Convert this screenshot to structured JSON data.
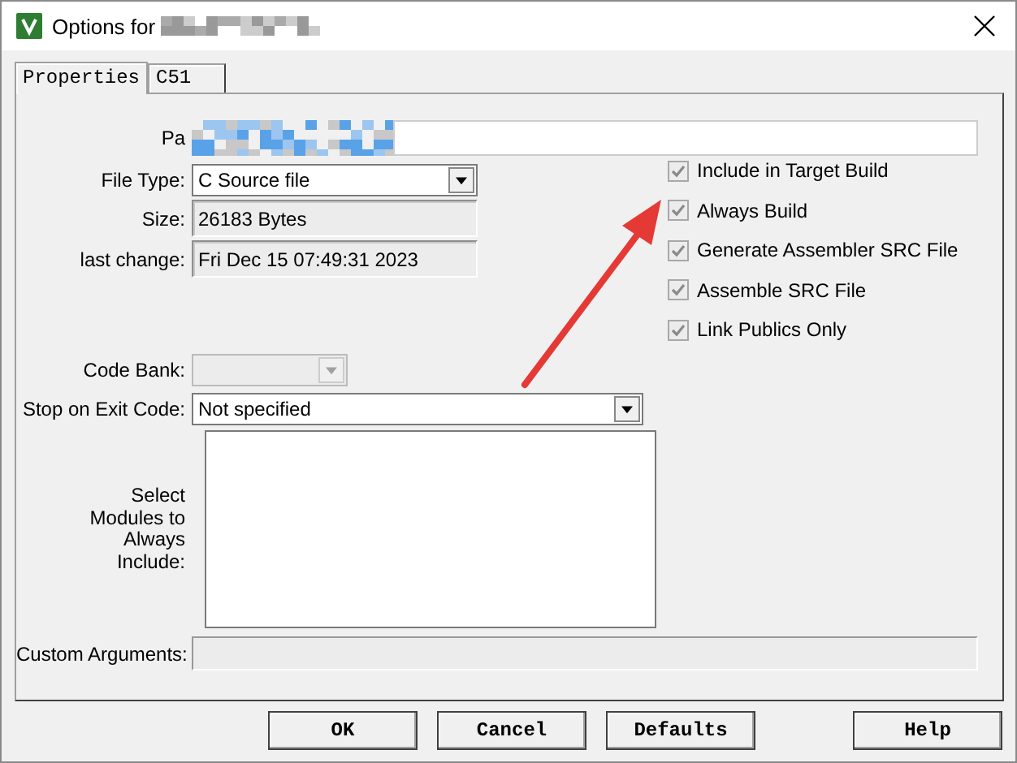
{
  "window": {
    "title": "Options for"
  },
  "tabs": [
    {
      "label": "Properties",
      "selected": true
    },
    {
      "label": "C51",
      "selected": false
    }
  ],
  "path": {
    "label": "Pa"
  },
  "file_type": {
    "label": "File Type:",
    "value": "C Source file"
  },
  "size": {
    "label": "Size:",
    "value": "26183 Bytes"
  },
  "last_change": {
    "label": "last change:",
    "value": "Fri Dec 15 07:49:31 2023"
  },
  "options": [
    {
      "label": "Include in Target Build",
      "checked": true,
      "disabled": true
    },
    {
      "label": "Always Build",
      "checked": true,
      "disabled": true
    },
    {
      "label": "Generate Assembler SRC File",
      "checked": true,
      "disabled": true
    },
    {
      "label": "Assemble SRC File",
      "checked": true,
      "disabled": true
    },
    {
      "label": "Link Publics Only",
      "checked": true,
      "disabled": true
    }
  ],
  "code_bank": {
    "label": "Code Bank:",
    "disabled": true
  },
  "stop_on_exit_code": {
    "label": "Stop on Exit Code:",
    "value": "Not specified"
  },
  "modules": {
    "label": "Select Modules to Always Include:"
  },
  "custom_arguments": {
    "label": "Custom Arguments:",
    "disabled": true
  },
  "buttons": [
    {
      "label": "OK"
    },
    {
      "label": "Cancel"
    },
    {
      "label": "Defaults"
    },
    {
      "label": "Help"
    }
  ]
}
